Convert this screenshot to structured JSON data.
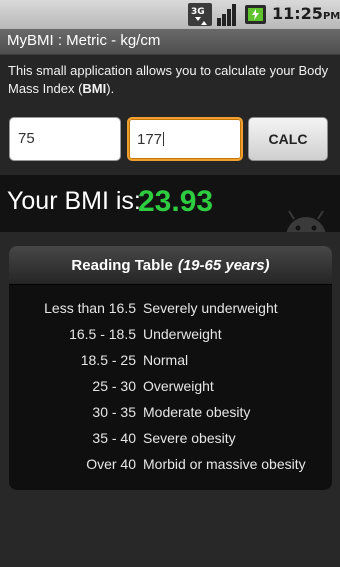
{
  "status_bar": {
    "network_icon": "3g-data-icon",
    "signal_icon": "signal-bars-icon",
    "battery_icon": "battery-charging-icon",
    "time": "11:25",
    "ampm": "PM"
  },
  "app": {
    "title": "MyBMI : Metric - kg/cm"
  },
  "intro": {
    "text_before": "This small application allows you to calculate your Body Mass Index (",
    "text_bold": "BMI",
    "text_after": ")."
  },
  "form": {
    "weight_value": "75",
    "height_value": "177",
    "calc_label": "CALC"
  },
  "result": {
    "label": "Your BMI is:",
    "value": "23.93",
    "value_color": "#2ecc40"
  },
  "reading_table": {
    "title": "Reading Table",
    "subtitle": "(19-65 years)",
    "rows": [
      {
        "range": "Less than 16.5",
        "description": "Severely underweight"
      },
      {
        "range": "16.5 - 18.5",
        "description": "Underweight"
      },
      {
        "range": "18.5 - 25",
        "description": "Normal"
      },
      {
        "range": "25 - 30",
        "description": "Overweight"
      },
      {
        "range": "30 - 35",
        "description": "Moderate obesity"
      },
      {
        "range": "35 - 40",
        "description": "Severe obesity"
      },
      {
        "range": "Over 40",
        "description": "Morbid or massive obesity"
      }
    ]
  }
}
